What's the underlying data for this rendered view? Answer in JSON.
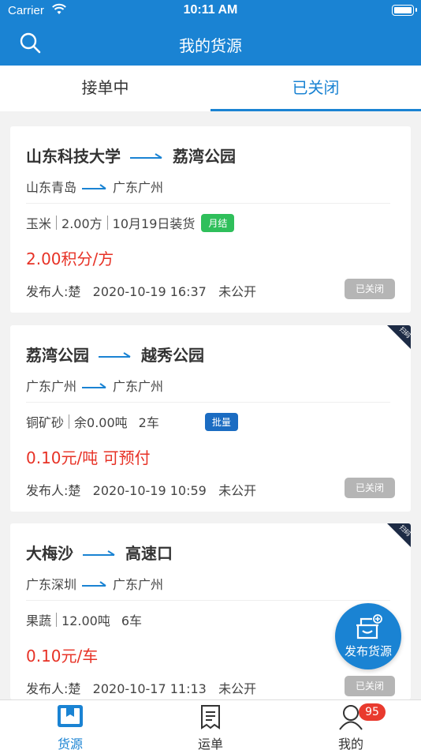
{
  "status_bar": {
    "carrier": "Carrier",
    "time": "10:11 AM"
  },
  "header": {
    "title": "我的货源",
    "search_icon": "search-icon"
  },
  "tabs": [
    {
      "label": "接单中",
      "active": false
    },
    {
      "label": "已关闭",
      "active": true
    }
  ],
  "cards": [
    {
      "from": "山东科技大学",
      "to": "荔湾公园",
      "from_region": "山东青岛",
      "to_region": "广东广州",
      "cargo": "玉米",
      "amount": "2.00方",
      "extra": "10月19日装货",
      "badge": "月结",
      "badge_color": "#2fbf5b",
      "price": "2.00积分/方",
      "publisher": "发布人:楚",
      "datetime": "2020-10-19 16:37",
      "visibility": "未公开",
      "status": "已关闭",
      "corner": ""
    },
    {
      "from": "荔湾公园",
      "to": "越秀公园",
      "from_region": "广东广州",
      "to_region": "广东广州",
      "cargo": "铜矿砂",
      "amount": "余0.00吨",
      "extra": "2车",
      "badge": "批量",
      "badge_color": "#1b6cc2",
      "price": "0.10元/吨 可预付",
      "publisher": "发布人:楚",
      "datetime": "2020-10-19 10:59",
      "visibility": "未公开",
      "status": "已关闭",
      "corner": "扫码"
    },
    {
      "from": "大梅沙",
      "to": "高速口",
      "from_region": "广东深圳",
      "to_region": "广东广州",
      "cargo": "果蔬",
      "amount": "12.00吨",
      "extra": "6车",
      "badge": "",
      "badge_color": "",
      "price": "0.10元/车",
      "publisher": "发布人:楚",
      "datetime": "2020-10-17 11:13",
      "visibility": "未公开",
      "status": "已关闭",
      "corner": "扫码"
    }
  ],
  "fab": {
    "label": "发布货源",
    "icon": "publish-cargo-icon"
  },
  "tabbar": {
    "items": [
      {
        "label": "货源",
        "icon": "cargo-icon",
        "active": true
      },
      {
        "label": "运单",
        "icon": "waybill-icon",
        "active": false
      },
      {
        "label": "我的",
        "icon": "profile-icon",
        "active": false
      }
    ],
    "badge": "95"
  },
  "colors": {
    "primary": "#1a83d3",
    "price": "#e73226",
    "closed": "#b5b5b5",
    "badge_red": "#e93a2e"
  }
}
